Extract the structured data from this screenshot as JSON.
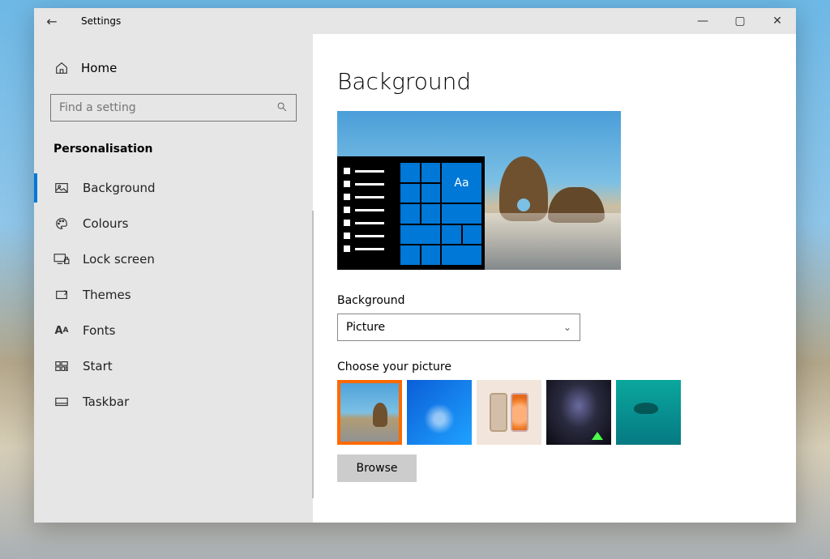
{
  "header": {
    "back_icon": "←",
    "title": "Settings"
  },
  "window_controls": {
    "minimize": "—",
    "maximize": "▢",
    "close": "✕"
  },
  "sidebar": {
    "home_label": "Home",
    "search_placeholder": "Find a setting",
    "category_title": "Personalisation",
    "items": [
      {
        "icon": "image",
        "label": "Background",
        "active": true
      },
      {
        "icon": "palette",
        "label": "Colours"
      },
      {
        "icon": "lock",
        "label": "Lock screen"
      },
      {
        "icon": "pencil",
        "label": "Themes"
      },
      {
        "icon": "font",
        "label": "Fonts"
      },
      {
        "icon": "grid",
        "label": "Start"
      },
      {
        "icon": "taskbar",
        "label": "Taskbar"
      }
    ]
  },
  "main": {
    "page_title": "Background",
    "preview_tile_text": "Aa",
    "background_label": "Background",
    "background_value": "Picture",
    "choose_label": "Choose your picture",
    "browse_label": "Browse"
  }
}
